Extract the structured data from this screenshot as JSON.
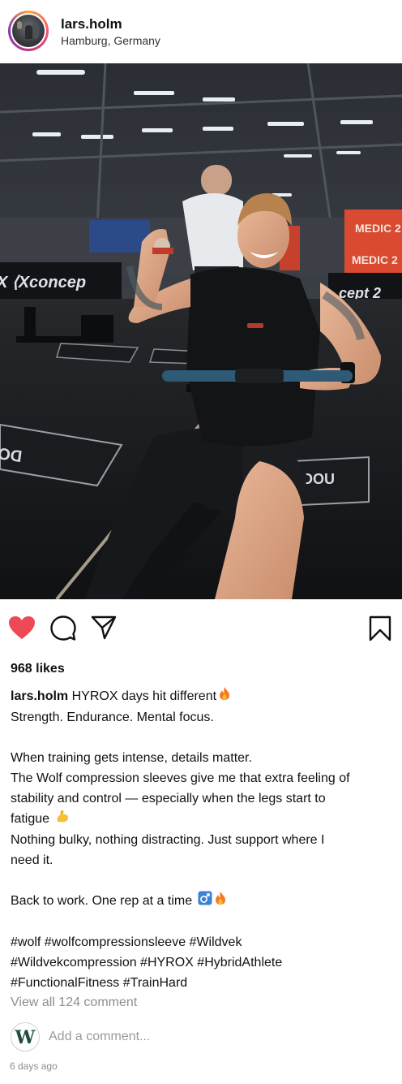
{
  "post": {
    "username": "lars.holm",
    "location": "Hamburg, Germany",
    "photo_alt": "Athlete on rowing machine",
    "likes": "968 likes",
    "caption": {
      "username": "lars.holm",
      "first_line": "HYROX days hit different",
      "lines": [
        "Strength. Endurance. Mental focus.",
        "",
        "When training gets intense, details matter.",
        "The Wolf compression sleeves give me that extra feeling of",
        "stability and control — especially when the legs start to",
        "fatigue",
        "Nothing bulky, nothing distracting. Just support where I",
        "need it.",
        "",
        "Back to work. One rep at a time",
        "",
        "#wolf #wolfcompressionsleeve #Wildvek",
        "#Wildvekcompression #HYROX #HybridAthlete",
        "#FunctionalFitness #TrainHard"
      ]
    },
    "view_comments": "View all 124 comment",
    "comment_placeholder": "Add a comment...",
    "comment_avatar_letter": "W",
    "timestamp": "6 days ago"
  },
  "icons": {
    "like": "heart-filled-icon",
    "comment": "speech-bubble-icon",
    "share": "paper-plane-icon",
    "save": "bookmark-icon",
    "fire": "fire-emoji",
    "muscle": "flexed-biceps-emoji",
    "male": "male-sign-emoji"
  },
  "colors": {
    "like": "#ed4956",
    "muted": "#8e8e8e",
    "text": "#111111",
    "brand_avatar": "#1f4d3a"
  }
}
